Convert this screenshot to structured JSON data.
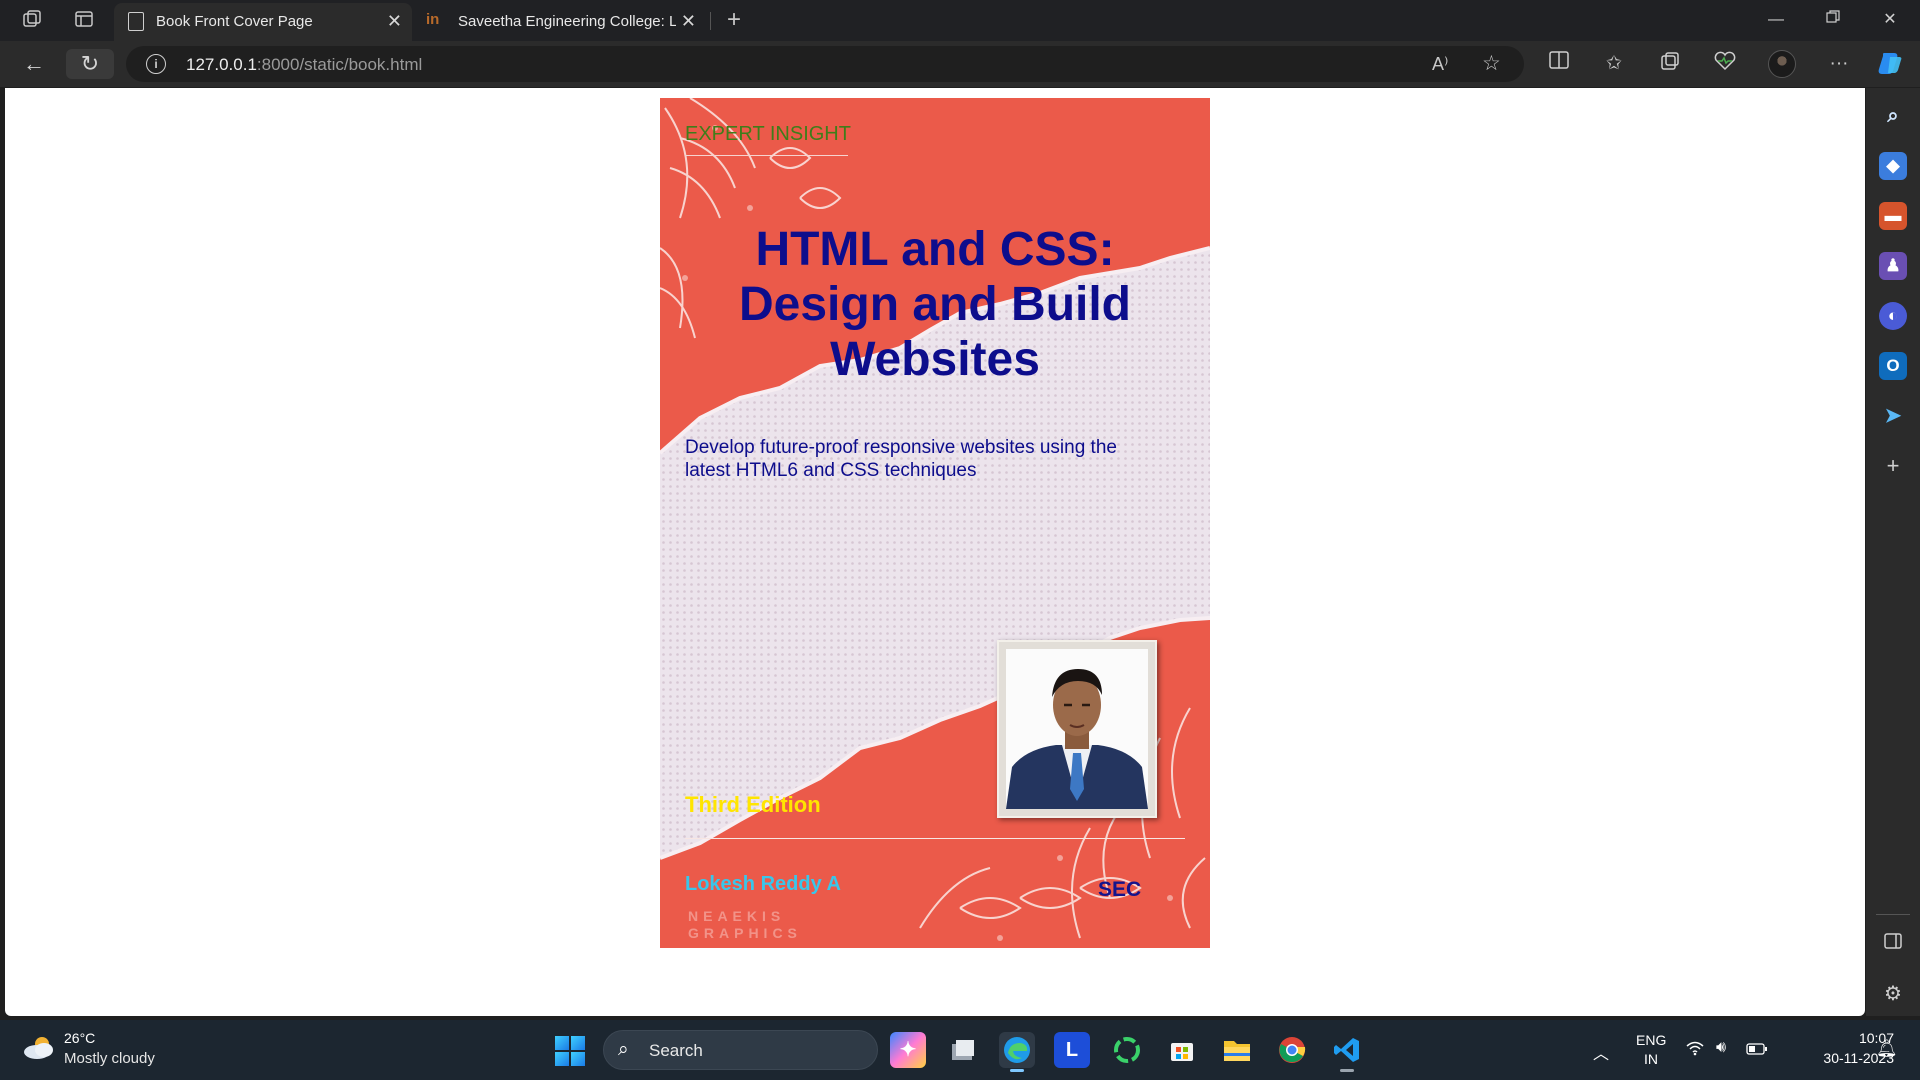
{
  "browser": {
    "tabs": [
      {
        "title": "Book Front Cover Page",
        "active": true,
        "icon": "page-icon"
      },
      {
        "title": "Saveetha Engineering College: Lo",
        "active": false,
        "icon": "site-icon"
      }
    ],
    "url_host": "127.0.0.1",
    "url_path": ":8000/static/book.html",
    "read_aloud_label": "A⁾"
  },
  "book": {
    "eyebrow": "EXPERT INSIGHT",
    "title": "HTML and CSS: Design and Build Websites",
    "subtitle": "Develop future-proof responsive websites using the latest HTML6 and CSS techniques",
    "edition": "Third Edition",
    "author": "Lokesh Reddy A",
    "publisher": "SEC",
    "watermark_line1": "NEAEKIS",
    "watermark_line2": "GRAPHICS",
    "colors": {
      "background": "#eb5a4a",
      "title": "#0d0d8c",
      "eyebrow": "#3f7d1a",
      "edition": "#ffe500",
      "author": "#39c6ea"
    }
  },
  "taskbar": {
    "weather_temp": "26°C",
    "weather_desc": "Mostly cloudy",
    "search_label": "Search",
    "language": "ENG",
    "region": "IN",
    "time": "10:07",
    "date": "30-11-2023",
    "apps": [
      "copilot-pre-icon",
      "file-manager-icon",
      "edge-icon",
      "l-app-icon",
      "loop-app-icon",
      "store-icon",
      "explorer-folder-icon",
      "chrome-icon",
      "vscode-icon"
    ]
  }
}
